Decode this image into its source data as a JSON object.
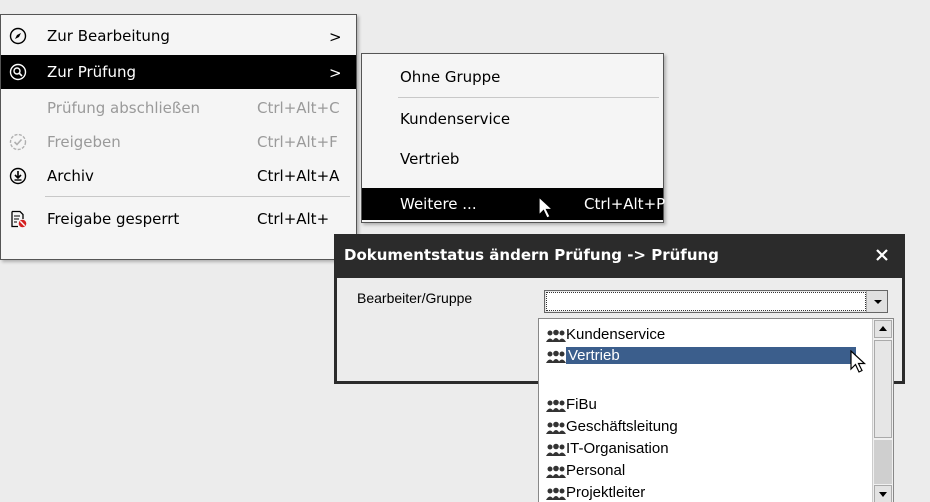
{
  "menu": {
    "items": [
      {
        "label": "Zur Bearbeitung",
        "shortcut": "",
        "arrow": ">",
        "icon": "compass-icon"
      },
      {
        "label": "Zur Prüfung",
        "shortcut": "",
        "arrow": ">",
        "icon": "review-icon"
      },
      {
        "label": "Prüfung abschließen",
        "shortcut": "Ctrl+Alt+C",
        "arrow": "",
        "icon": ""
      },
      {
        "label": "Freigeben",
        "shortcut": "Ctrl+Alt+F",
        "arrow": "",
        "icon": "approve-check-icon"
      },
      {
        "label": "Archiv",
        "shortcut": "Ctrl+Alt+A",
        "arrow": "",
        "icon": "archive-icon"
      },
      {
        "label": "Freigabe gesperrt",
        "shortcut": "Ctrl+Alt+",
        "arrow": "",
        "icon": "locked-document-icon"
      }
    ]
  },
  "submenu": {
    "items": [
      {
        "label": "Ohne Gruppe",
        "shortcut": ""
      },
      {
        "label": "Kundenservice",
        "shortcut": ""
      },
      {
        "label": "Vertrieb",
        "shortcut": ""
      },
      {
        "label": "Weitere ...",
        "shortcut": "Ctrl+Alt+P"
      }
    ]
  },
  "dialog": {
    "title": "Dokumentstatus ändern Prüfung -> Prüfung",
    "field_label": "Bearbeiter/Gruppe",
    "combo_value": ""
  },
  "dropdown": {
    "items": [
      "Kundenservice",
      "Vertrieb",
      "",
      "FiBu",
      "Geschäftsleitung",
      "IT-Organisation",
      "Personal",
      "Projektleiter"
    ],
    "selected": "Vertrieb"
  },
  "colors": {
    "highlight": "#000000",
    "selection": "#3b5e8c",
    "dialog_titlebar": "#2b2b2b",
    "disabled_text": "#9a9a9a"
  }
}
